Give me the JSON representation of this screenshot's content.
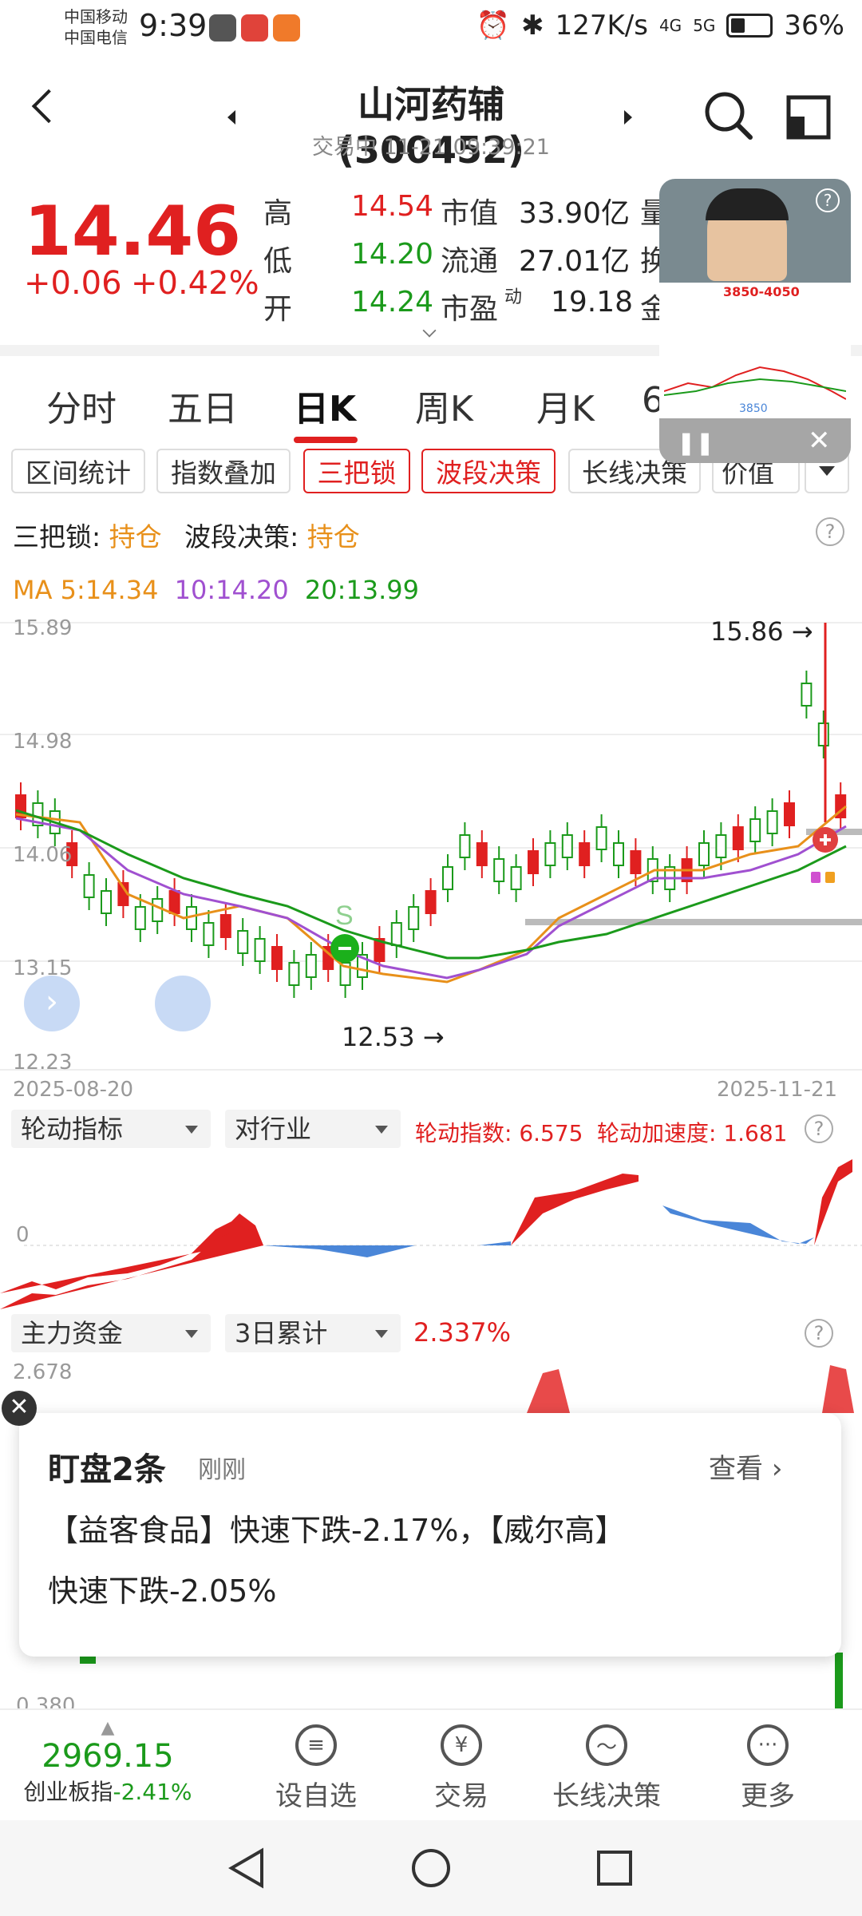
{
  "statusbar": {
    "carrier1": "中国移动",
    "carrier2": "中国电信",
    "time": "9:39",
    "net_speed": "127K/s",
    "net4g": "4G",
    "net5g": "5G",
    "battery": "36%"
  },
  "header": {
    "title": "山河药辅(300452)",
    "subtitle": "交易中 11-21 09:39:21"
  },
  "quote": {
    "price": "14.46",
    "change": "+0.06",
    "change_pct": "+0.42%",
    "rows": [
      {
        "label": "高",
        "value": "14.54",
        "label2": "市值",
        "value2": "33.90亿",
        "label3": "量"
      },
      {
        "label": "低",
        "value": "14.20",
        "label2": "流通",
        "value2": "27.01亿",
        "label3": "换"
      },
      {
        "label": "开",
        "value": "14.24",
        "label2": "市盈",
        "sup": "动",
        "value2": "19.18",
        "label3": "金"
      }
    ]
  },
  "video": {
    "overlay_text": "3850-4050",
    "bottom_text": "3850"
  },
  "tabs": [
    "分时",
    "五日",
    "日K",
    "周K",
    "月K",
    "6"
  ],
  "chips": [
    "区间统计",
    "指数叠加",
    "三把锁",
    "波段决策",
    "长线决策",
    "价值"
  ],
  "status_line": {
    "label1": "三把锁:",
    "value1": "持仓",
    "label2": "波段决策:",
    "value2": "持仓"
  },
  "ma": {
    "ma5": "MA 5:14.34",
    "ma10": "10:14.20",
    "ma20": "20:13.99"
  },
  "chart_data": {
    "type": "candlestick",
    "yaxis_ticks": [
      "15.89",
      "14.98",
      "14.06",
      "13.15",
      "12.23"
    ],
    "high_label": "15.86",
    "low_label": "12.53",
    "start_date": "2025-08-20",
    "end_date": "2025-11-21"
  },
  "indicator1": {
    "dropdown1": "轮动指标",
    "dropdown2": "对行业",
    "label1": "轮动指数: 6.575",
    "label2": "轮动加速度: 1.681",
    "zero": "0"
  },
  "indicator2": {
    "dropdown1": "主力资金",
    "dropdown2": "3日累计",
    "value": "2.337%",
    "top": "2.678",
    "bottom": "0.380"
  },
  "popup": {
    "title": "盯盘2条",
    "time": "刚刚",
    "view": "查看",
    "text1": "【益客食品】快速下跌-2.17%，【威尔高】",
    "text2": "快速下跌-2.05%"
  },
  "bottom": {
    "index_value": "2969.15",
    "index_name": "创业板指",
    "index_pct": "-2.41%",
    "nav": [
      "设自选",
      "交易",
      "长线决策",
      "更多"
    ]
  }
}
